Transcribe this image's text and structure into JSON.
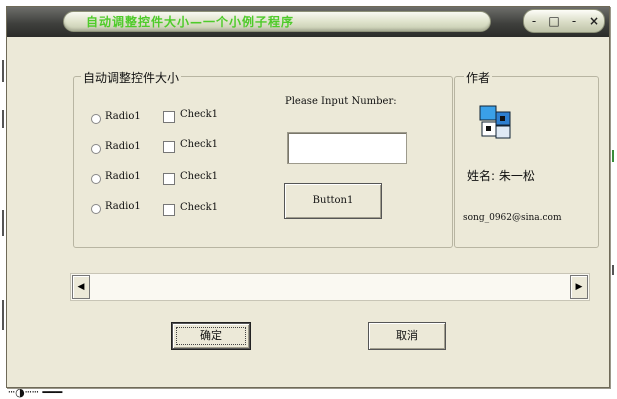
{
  "window": {
    "title": "自动调整控件大小—一个小例子程序",
    "controls": {
      "dash_left": "-",
      "restore": "□",
      "dash_right": "-",
      "close": "×"
    }
  },
  "autosize_group": {
    "legend": "自动调整控件大小",
    "rows": [
      {
        "radio": "Radio1",
        "check": "Check1"
      },
      {
        "radio": "Radio1",
        "check": "Check1"
      },
      {
        "radio": "Radio1",
        "check": "Check1"
      },
      {
        "radio": "Radio1",
        "check": "Check1"
      }
    ],
    "prompt": "Please Input  Number:",
    "input_value": "",
    "button1": "Button1"
  },
  "author_group": {
    "legend": "作者",
    "icon": "stacked-blocks-icon",
    "name": "姓名: 朱一松",
    "email": "song_0962@sina.com"
  },
  "scrollbar": {
    "left_arrow": "◀",
    "right_arrow": "▶"
  },
  "buttons": {
    "ok": "确定",
    "cancel": "取消"
  },
  "background": {
    "text": "ⵈ◑ⵈⵈ ━━━"
  }
}
